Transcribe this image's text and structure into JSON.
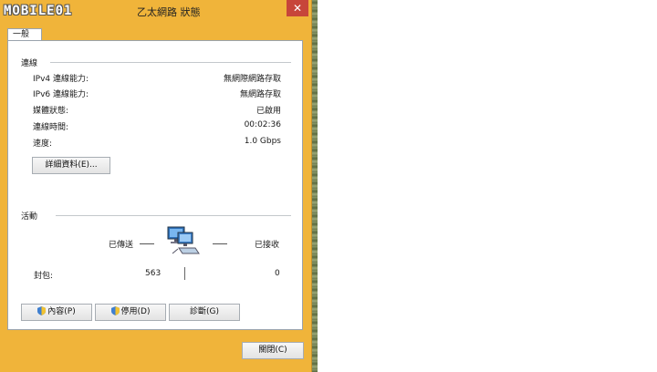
{
  "window": {
    "title": "乙太網路 狀態",
    "logo_text": "MOBILE01",
    "close_glyph": "✕"
  },
  "tab": {
    "label": "一般"
  },
  "connection": {
    "section_label": "連線",
    "rows": [
      {
        "label": "IPv4 連線能力:",
        "value": "無網際網路存取"
      },
      {
        "label": "IPv6 連線能力:",
        "value": "無網路存取"
      },
      {
        "label": "媒體狀態:",
        "value": "已啟用"
      },
      {
        "label": "連線時間:",
        "value": "00:02:36"
      },
      {
        "label": "速度:",
        "value": "1.0 Gbps"
      }
    ],
    "details_button": "詳細資料(E)..."
  },
  "activity": {
    "section_label": "活動",
    "sent_label": "已傳送",
    "received_label": "已接收",
    "packets_label": "封包:",
    "packets_sent": "563",
    "packets_received": "0",
    "icon": "network-computers-icon"
  },
  "actions": {
    "properties": "內容(P)",
    "disable": "停用(D)",
    "diagnose": "診斷(G)"
  },
  "footer": {
    "close_button": "關閉(C)"
  },
  "colors": {
    "frame": "#f0b43a",
    "close": "#c7453a",
    "panel": "#ffffff"
  }
}
